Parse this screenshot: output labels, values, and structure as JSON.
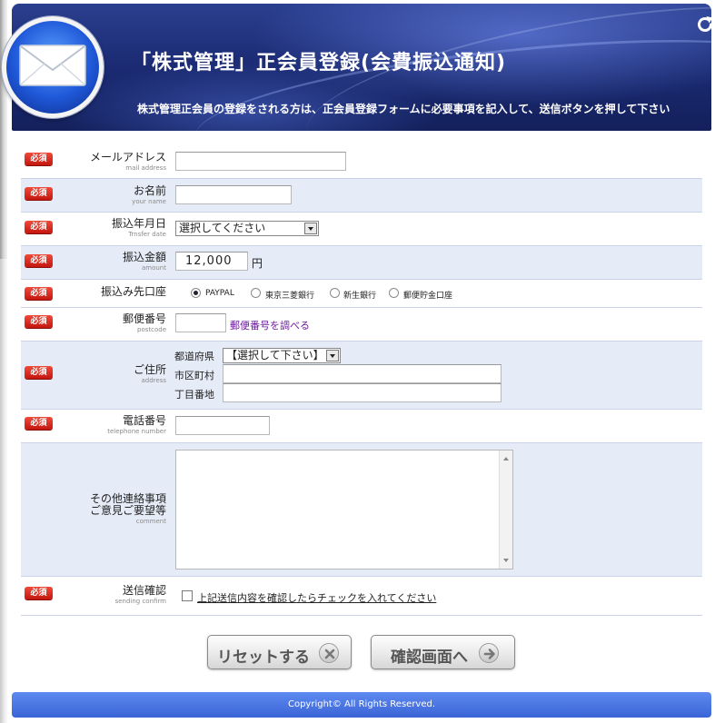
{
  "header": {
    "title": "「株式管理」正会員登録(会費振込通知)",
    "subtitle": "株式管理正会員の登録をされる方は、正会員登録フォームに必要事項を記入して、送信ボタンを押して下さい",
    "refresh_icon": "refresh-icon",
    "logo_icon": "envelope-icon"
  },
  "required_badge": "必須",
  "fields": {
    "email": {
      "label": "メールアドレス",
      "sublabel": "mail address",
      "value": ""
    },
    "name": {
      "label": "お名前",
      "sublabel": "your name",
      "value": ""
    },
    "date": {
      "label": "振込年月日",
      "sublabel": "Trnsfer date",
      "selected": "選択してください"
    },
    "amount": {
      "label": "振込金額",
      "sublabel": "amount",
      "value": "12,000",
      "unit": "円"
    },
    "account": {
      "label": "振込み先口座",
      "options": [
        "PAYPAL",
        "東京三菱銀行",
        "新生銀行",
        "郵便貯金口座"
      ],
      "selected": "PAYPAL"
    },
    "postcode": {
      "label": "郵便番号",
      "sublabel": "postcode",
      "value": "",
      "lookup_link": "郵便番号を調べる"
    },
    "address": {
      "label": "ご住所",
      "sublabel": "address",
      "prefecture_label": "都道府県",
      "prefecture_selected": "【選択して下さい】",
      "city_label": "市区町村",
      "city_value": "",
      "street_label": "丁目番地",
      "street_value": ""
    },
    "phone": {
      "label": "電話番号",
      "sublabel": "telephone number",
      "value": ""
    },
    "comment": {
      "label_line1": "その他連絡事項",
      "label_line2": "ご意見ご要望等",
      "sublabel": "comment",
      "value": ""
    },
    "confirm": {
      "label": "送信確認",
      "sublabel": "sending confirm",
      "checkbox_text": "上記送信内容を確認したらチェックを入れてください",
      "checked": false
    }
  },
  "buttons": {
    "reset_label": "リセットする",
    "reset_icon": "close-icon",
    "confirm_label": "確認画面へ",
    "confirm_icon": "arrow-right-icon"
  },
  "footer": {
    "copyright": "Copyright© All Rights Reserved."
  },
  "colors": {
    "header_bg": "#1c2c75",
    "badge": "#d8261b",
    "row_alt": "#e6ecf7",
    "footer": "#4a74e0",
    "link": "#6a1b9a"
  }
}
